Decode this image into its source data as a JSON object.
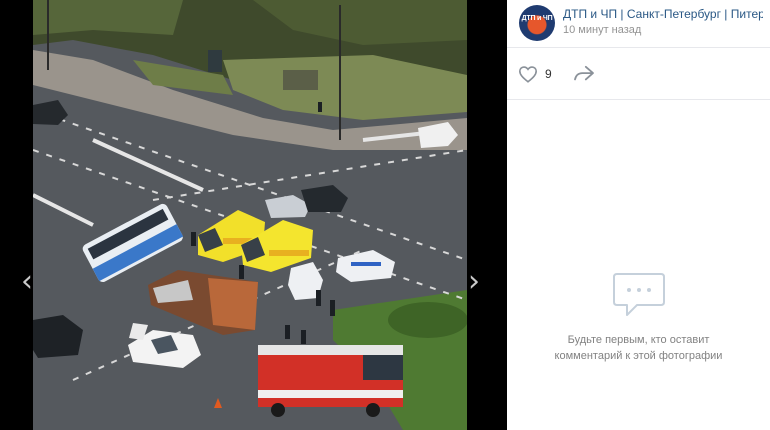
{
  "post": {
    "author_name": "ДТП и ЧП | Санкт-Петербург | Питер",
    "avatar_text": "ДТП и ЧП",
    "time": "10 минут назад"
  },
  "actions": {
    "like_count": "9",
    "like_icon": "heart-icon",
    "share_icon": "share-arrow-icon"
  },
  "comments": {
    "empty_line1": "Будьте первым, кто оставит",
    "empty_line2": "комментарий к этой фотографии",
    "icon": "comment-bubble-icon"
  },
  "viewer": {
    "prev_label": "‹",
    "next_label": "›"
  },
  "colors": {
    "link": "#2a5885",
    "muted": "#939393",
    "divider": "#e7e8ec"
  }
}
